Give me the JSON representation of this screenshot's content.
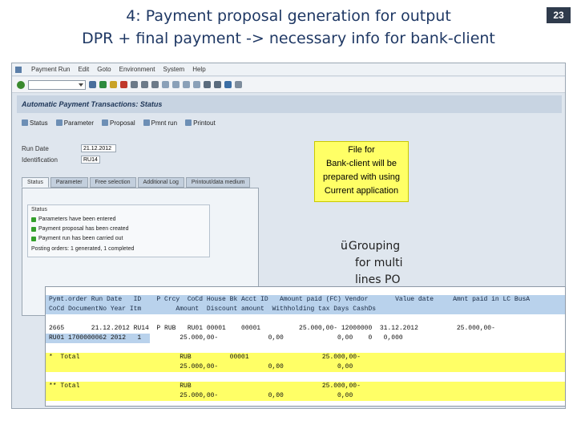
{
  "slide": {
    "title_line1": "4: Payment proposal generation for output",
    "title_line2": "DPR + final payment -> necessary info for bank-client",
    "number": "23"
  },
  "sap": {
    "menu": [
      "Payment Run",
      "Edit",
      "Goto",
      "Environment",
      "System",
      "Help"
    ],
    "app_title": "Automatic Payment Transactions: Status",
    "app_buttons": [
      "Status",
      "Parameter",
      "Proposal",
      "Pmnt run",
      "Printout"
    ],
    "fields": {
      "run_date_label": "Run Date",
      "run_date_value": "21.12.2012",
      "identification_label": "Identification",
      "identification_value": "RU14"
    },
    "tabs": [
      "Status",
      "Parameter",
      "Free selection",
      "Additional Log",
      "Printout/data medium"
    ],
    "status": {
      "title": "Status",
      "lines": [
        "Parameters have been entered",
        "Payment proposal has been created",
        "Payment run has been carried out"
      ],
      "posting_orders": "Posting orders: 1 generated, 1 completed"
    }
  },
  "callout": {
    "lines": [
      "File for",
      "Bank-client will be",
      "prepared with using",
      "Current application"
    ]
  },
  "grouping": {
    "check": "ü",
    "lines": [
      "Grouping",
      "for multi",
      "lines PO"
    ]
  },
  "list": {
    "header1": "Pymt.order Run Date   ID    P Crcy  CoCd House Bk Acct ID   Amount paid (FC) Vendor       Value date     Amnt paid in LC BusA",
    "header2": "CoCd DocumentNo Year Itm         Amount  Discount amount  Withholding tax Days CashDs",
    "rows": [
      {
        "text": "2665       21.12.2012 RU14  P RUB   RU01 00001    00001          25.000,00- 12000000  31.12.2012          25.000,00-",
        "style": "plain"
      },
      {
        "text": "RU01 1700000062 2012   1          25.000,00-             0,00              0,00    0   0,000",
        "style": "plain"
      },
      {
        "text": "*  Total                          RUB          00001                   25.000,00-",
        "style": "yellow"
      },
      {
        "text": "                                  25.000,00-             0,00              0,00",
        "style": "yellow"
      },
      {
        "text": "** Total                          RUB                                  25.000,00-",
        "style": "yellow"
      },
      {
        "text": "                                  25.000,00-             0,00              0,00",
        "style": "yellow"
      }
    ]
  },
  "colors": {
    "title": "#1f3864",
    "highlight": "#ffff66",
    "list_header": "#b9d2ec",
    "status_ok": "#34a02c"
  }
}
